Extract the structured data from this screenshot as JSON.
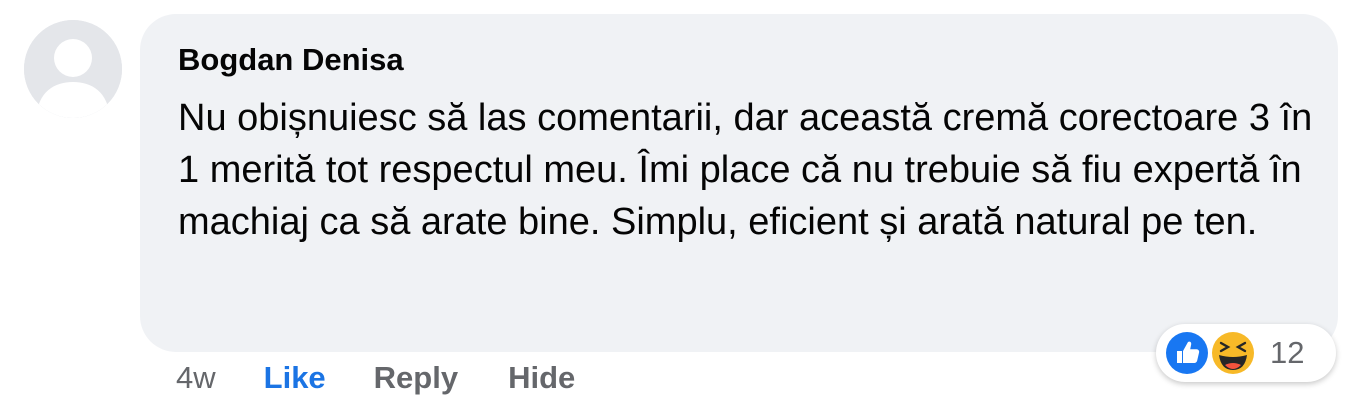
{
  "comment": {
    "author": "Bogdan Denisa",
    "text": "Nu obișnuiesc să las comentarii, dar această cremă corectoare 3 în 1 merită tot respectul meu. Îmi place că nu trebuie să fiu expertă în machiaj ca să arate bine. Simplu, eficient și arată natural pe ten.",
    "timestamp": "4w",
    "actions": {
      "like": "Like",
      "reply": "Reply",
      "hide": "Hide"
    },
    "reactions": {
      "types": [
        "like-icon",
        "haha-icon"
      ],
      "count": "12"
    }
  },
  "colors": {
    "bubble": "#f0f2f5",
    "link_blue": "#1b74e4",
    "muted": "#65676b",
    "like_blue": "#1877f2",
    "haha_yellow": "#f7b928"
  }
}
